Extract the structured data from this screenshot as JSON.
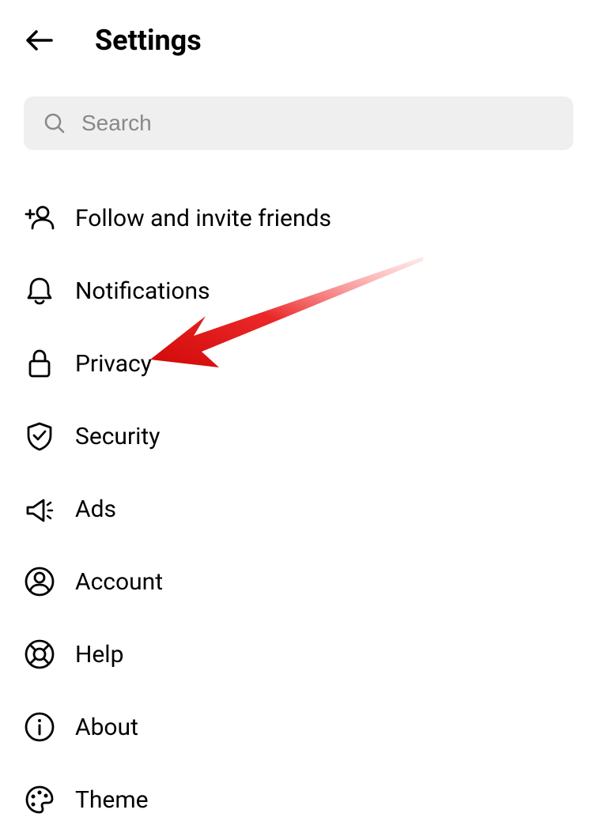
{
  "header": {
    "title": "Settings"
  },
  "search": {
    "placeholder": "Search"
  },
  "menu": {
    "items": [
      {
        "label": "Follow and invite friends",
        "icon": "add-person-icon"
      },
      {
        "label": "Notifications",
        "icon": "bell-icon"
      },
      {
        "label": "Privacy",
        "icon": "lock-icon"
      },
      {
        "label": "Security",
        "icon": "shield-icon"
      },
      {
        "label": "Ads",
        "icon": "megaphone-icon"
      },
      {
        "label": "Account",
        "icon": "person-circle-icon"
      },
      {
        "label": "Help",
        "icon": "lifebuoy-icon"
      },
      {
        "label": "About",
        "icon": "info-icon"
      },
      {
        "label": "Theme",
        "icon": "palette-icon"
      }
    ]
  },
  "annotation": {
    "target": "Privacy",
    "color": "#e91010"
  }
}
